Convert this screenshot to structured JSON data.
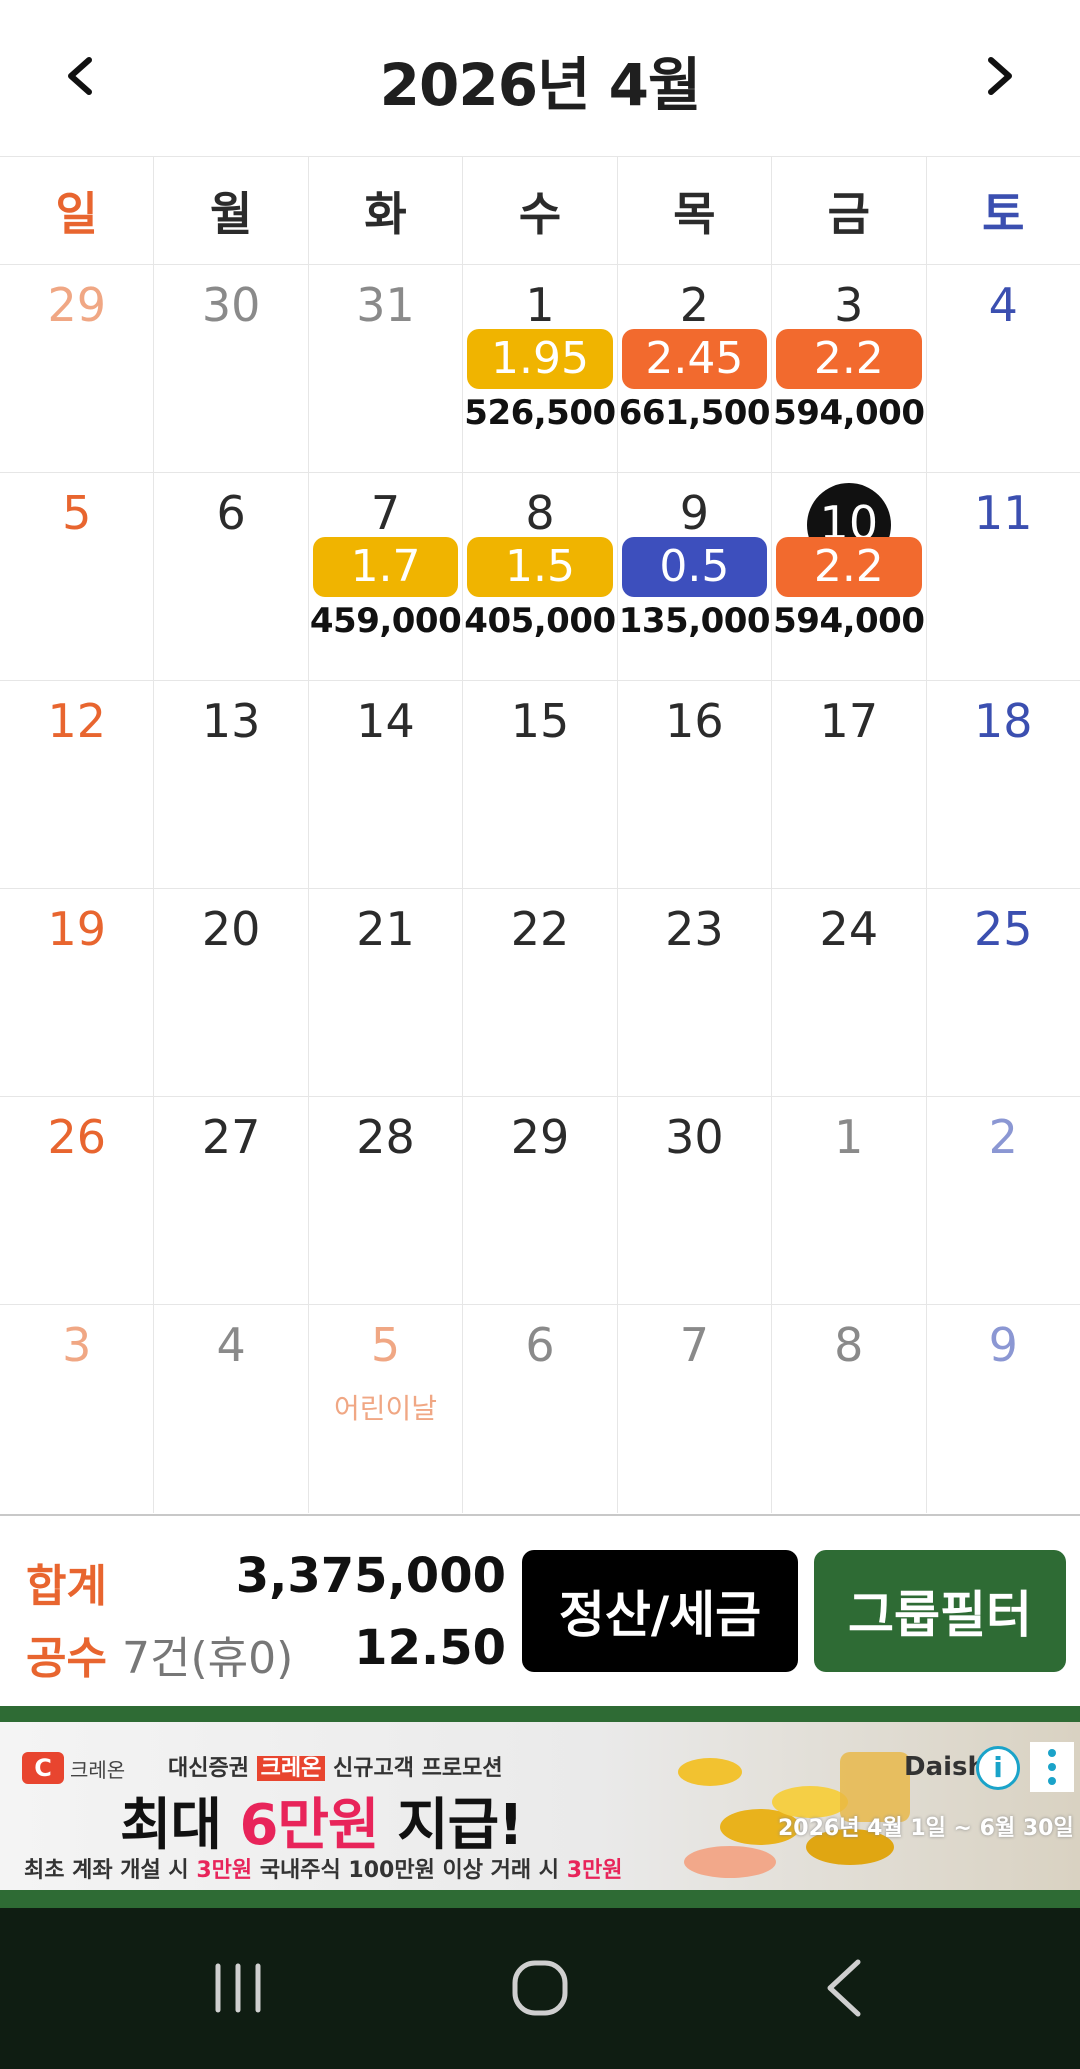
{
  "header": {
    "title": "2026년 4월",
    "prev_icon": "chevron-left-icon",
    "next_icon": "chevron-right-icon"
  },
  "weekdays": [
    "일",
    "월",
    "화",
    "수",
    "목",
    "금",
    "토"
  ],
  "weeks": [
    [
      {
        "day": "29",
        "other": true
      },
      {
        "day": "30",
        "other": true
      },
      {
        "day": "31",
        "other": true
      },
      {
        "day": "1",
        "badge": "1.95",
        "badge_color": "yellow",
        "amount": "526,500"
      },
      {
        "day": "2",
        "badge": "2.45",
        "badge_color": "orange",
        "amount": "661,500"
      },
      {
        "day": "3",
        "badge": "2.2",
        "badge_color": "orange",
        "amount": "594,000"
      },
      {
        "day": "4"
      }
    ],
    [
      {
        "day": "5"
      },
      {
        "day": "6"
      },
      {
        "day": "7",
        "badge": "1.7",
        "badge_color": "yellow",
        "amount": "459,000"
      },
      {
        "day": "8",
        "badge": "1.5",
        "badge_color": "yellow",
        "amount": "405,000"
      },
      {
        "day": "9",
        "badge": "0.5",
        "badge_color": "blue",
        "amount": "135,000"
      },
      {
        "day": "10",
        "today": true,
        "badge": "2.2",
        "badge_color": "orange",
        "amount": "594,000"
      },
      {
        "day": "11"
      }
    ],
    [
      {
        "day": "12"
      },
      {
        "day": "13"
      },
      {
        "day": "14"
      },
      {
        "day": "15"
      },
      {
        "day": "16"
      },
      {
        "day": "17"
      },
      {
        "day": "18"
      }
    ],
    [
      {
        "day": "19"
      },
      {
        "day": "20"
      },
      {
        "day": "21"
      },
      {
        "day": "22"
      },
      {
        "day": "23"
      },
      {
        "day": "24"
      },
      {
        "day": "25"
      }
    ],
    [
      {
        "day": "26"
      },
      {
        "day": "27"
      },
      {
        "day": "28"
      },
      {
        "day": "29"
      },
      {
        "day": "30"
      },
      {
        "day": "1",
        "other": true
      },
      {
        "day": "2",
        "other": true
      }
    ],
    [
      {
        "day": "3",
        "other": true
      },
      {
        "day": "4",
        "other": true
      },
      {
        "day": "5",
        "other": true,
        "holiday": "어린이날"
      },
      {
        "day": "6",
        "other": true
      },
      {
        "day": "7",
        "other": true
      },
      {
        "day": "8",
        "other": true
      },
      {
        "day": "9",
        "other": true
      }
    ]
  ],
  "summary": {
    "total_label": "합계",
    "total_value": "3,375,000",
    "count_label": "공수",
    "count_sub": "7건(휴0)",
    "count_value": "12.50",
    "settle_button": "정산/세금",
    "group_button": "그룹필터"
  },
  "ad": {
    "brand_logo": "C",
    "brand": "크레온",
    "top_text_pre": "대신증권",
    "top_text_hl": "크레온",
    "top_text_post": "신규고객 프로모션",
    "main_pre": "최대",
    "main_red": "6만원",
    "main_post": "지급!",
    "bottom_pre": "최초 계좌 개설 시",
    "bottom_red1": "3만원",
    "bottom_mid": "국내주식 100만원 이상 거래 시",
    "bottom_red2": "3만원",
    "date": "2026년 4월 1일 ~ 6월 30일",
    "daishin": "Daish",
    "info_icon": "i"
  },
  "colors": {
    "sunday": "#e8652f",
    "saturday": "#3b4fb0",
    "badge_yellow": "#f0b400",
    "badge_orange": "#f26a2e",
    "badge_blue": "#3d4fbd",
    "group_button": "#2e6b34"
  }
}
